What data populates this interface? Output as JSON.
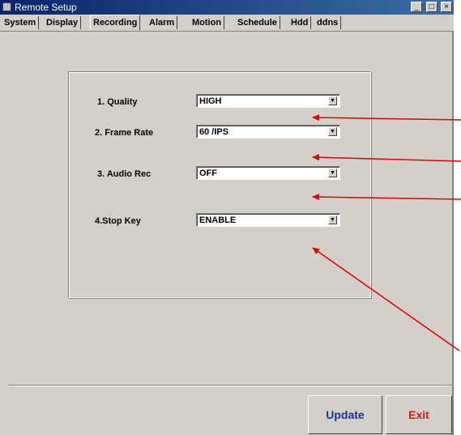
{
  "window": {
    "title": "Remote Setup",
    "controls": [
      "_",
      "□",
      "×"
    ]
  },
  "tabs": [
    {
      "label": "System"
    },
    {
      "label": "Display"
    },
    {
      "label": "Recording",
      "active": true
    },
    {
      "label": "Alarm"
    },
    {
      "label": "Motion"
    },
    {
      "label": "Schedule"
    },
    {
      "label": "Hdd"
    },
    {
      "label": "ddns"
    }
  ],
  "settings": [
    {
      "label": "1. Quality",
      "value": "HIGH"
    },
    {
      "label": "2. Frame Rate",
      "value": "60 /IPS"
    },
    {
      "label": "3. Audio Rec",
      "value": "OFF"
    },
    {
      "label": "4.Stop Key",
      "value": "ENABLE"
    }
  ],
  "buttons": {
    "update": "Update",
    "exit": "Exit"
  },
  "colors": {
    "annotation_arrow": "#e00000",
    "update_text": "#1a2fa0",
    "exit_text": "#cc1a1a"
  }
}
